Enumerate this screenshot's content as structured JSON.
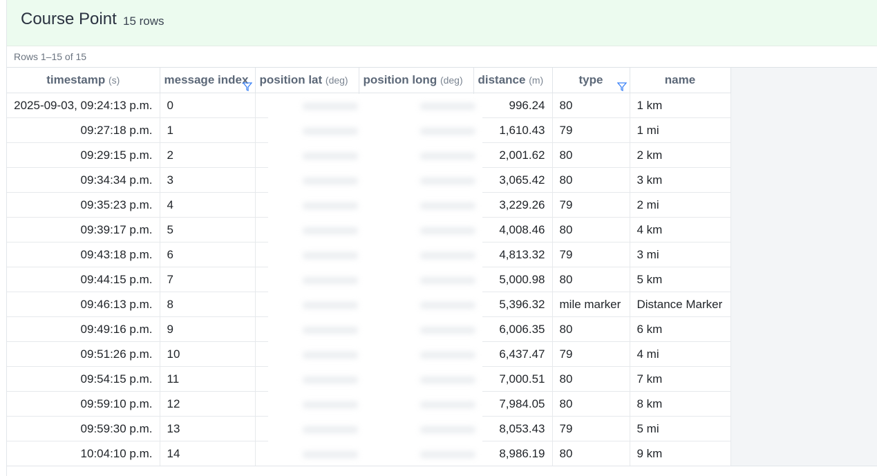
{
  "header": {
    "title": "Course Point",
    "row_count": "15 rows"
  },
  "pager": {
    "info": "Rows 1–15 of 15"
  },
  "columns": [
    {
      "label": "timestamp",
      "unit": "(s)"
    },
    {
      "label": "message index",
      "unit": ""
    },
    {
      "label": "position lat",
      "unit": "(deg)"
    },
    {
      "label": "position long",
      "unit": "(deg)"
    },
    {
      "label": "distance",
      "unit": "(m)"
    },
    {
      "label": "type",
      "unit": ""
    },
    {
      "label": "name",
      "unit": ""
    }
  ],
  "rows": [
    {
      "timestamp": "2025-09-03, 09:24:13 p.m.",
      "index": "0",
      "distance": "996.24",
      "type": "80",
      "name": "1 km"
    },
    {
      "timestamp": "09:27:18 p.m.",
      "index": "1",
      "distance": "1,610.43",
      "type": "79",
      "name": "1 mi"
    },
    {
      "timestamp": "09:29:15 p.m.",
      "index": "2",
      "distance": "2,001.62",
      "type": "80",
      "name": "2 km"
    },
    {
      "timestamp": "09:34:34 p.m.",
      "index": "3",
      "distance": "3,065.42",
      "type": "80",
      "name": "3 km"
    },
    {
      "timestamp": "09:35:23 p.m.",
      "index": "4",
      "distance": "3,229.26",
      "type": "79",
      "name": "2 mi"
    },
    {
      "timestamp": "09:39:17 p.m.",
      "index": "5",
      "distance": "4,008.46",
      "type": "80",
      "name": "4 km"
    },
    {
      "timestamp": "09:43:18 p.m.",
      "index": "6",
      "distance": "4,813.32",
      "type": "79",
      "name": "3 mi"
    },
    {
      "timestamp": "09:44:15 p.m.",
      "index": "7",
      "distance": "5,000.98",
      "type": "80",
      "name": "5 km"
    },
    {
      "timestamp": "09:46:13 p.m.",
      "index": "8",
      "distance": "5,396.32",
      "type": "mile marker",
      "name": "Distance Marker"
    },
    {
      "timestamp": "09:49:16 p.m.",
      "index": "9",
      "distance": "6,006.35",
      "type": "80",
      "name": "6 km"
    },
    {
      "timestamp": "09:51:26 p.m.",
      "index": "10",
      "distance": "6,437.47",
      "type": "79",
      "name": "4 mi"
    },
    {
      "timestamp": "09:54:15 p.m.",
      "index": "11",
      "distance": "7,000.51",
      "type": "80",
      "name": "7 km"
    },
    {
      "timestamp": "09:59:10 p.m.",
      "index": "12",
      "distance": "7,984.05",
      "type": "80",
      "name": "8 km"
    },
    {
      "timestamp": "09:59:30 p.m.",
      "index": "13",
      "distance": "8,053.43",
      "type": "79",
      "name": "5 mi"
    },
    {
      "timestamp": "10:04:10 p.m.",
      "index": "14",
      "distance": "8,986.19",
      "type": "80",
      "name": "9 km"
    }
  ],
  "colors": {
    "header_bg": "#ecfbef",
    "filter_icon": "#3b82f6",
    "blank_area": "#f3f5f7"
  },
  "icons": {
    "filter": "funnel-filter-icon"
  }
}
